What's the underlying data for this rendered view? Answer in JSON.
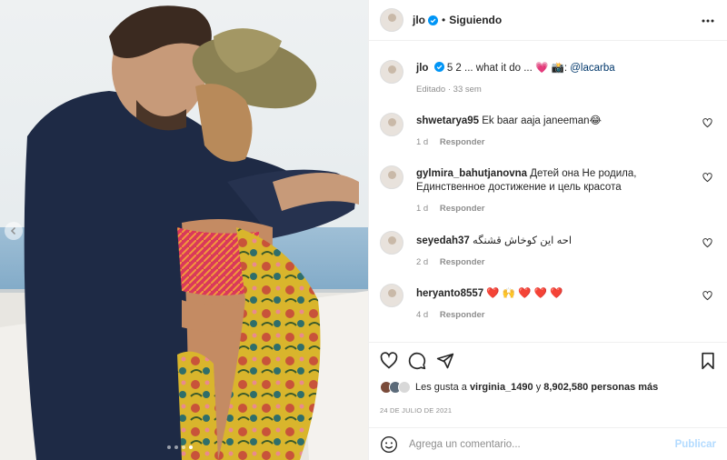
{
  "post": {
    "username": "jlo",
    "dot": "•",
    "follow_status": "Siguiendo",
    "caption": {
      "text": "5 2 ... what it do ... 💗 📸:",
      "mention": "@lacarba",
      "edited": "Editado · 33 sem"
    },
    "photo_alt": "Couple kissing on a yacht",
    "carousel": {
      "count": 4,
      "active": 4
    }
  },
  "comments": [
    {
      "user": "shwetarya95",
      "text": "Ek baar aaja janeeman😂",
      "time": "1 d",
      "reply": "Responder"
    },
    {
      "user": "gylmira_bahutjanovna",
      "text": "Детей она Не родила, Единственное достижение и цель красота",
      "time": "1 d",
      "reply": "Responder"
    },
    {
      "user": "seyedah37",
      "text": "احه این کوخاش قشنگه",
      "time": "2 d",
      "reply": "Responder"
    },
    {
      "user": "heryanto8557",
      "text": "❤️ 🙌 ❤️ ❤️ ❤️",
      "time": "4 d",
      "reply": "Responder"
    }
  ],
  "likes": {
    "prefix": "Les gusta a",
    "user": "virginia_1490",
    "middle": "y",
    "count": "8,902,580 personas más"
  },
  "date": "24 DE JULIO DE 2021",
  "composer": {
    "placeholder": "Agrega un comentario...",
    "publish_label": "Publicar"
  },
  "colors": {
    "verified": "#0095f6",
    "publish_disabled": "#b3dbff",
    "secondary_text": "#8e8e8e"
  },
  "icons": [
    "more-icon",
    "heart-icon",
    "comment-icon",
    "share-icon",
    "bookmark-icon",
    "emoji-icon",
    "chevron-left-icon",
    "verified-icon"
  ]
}
